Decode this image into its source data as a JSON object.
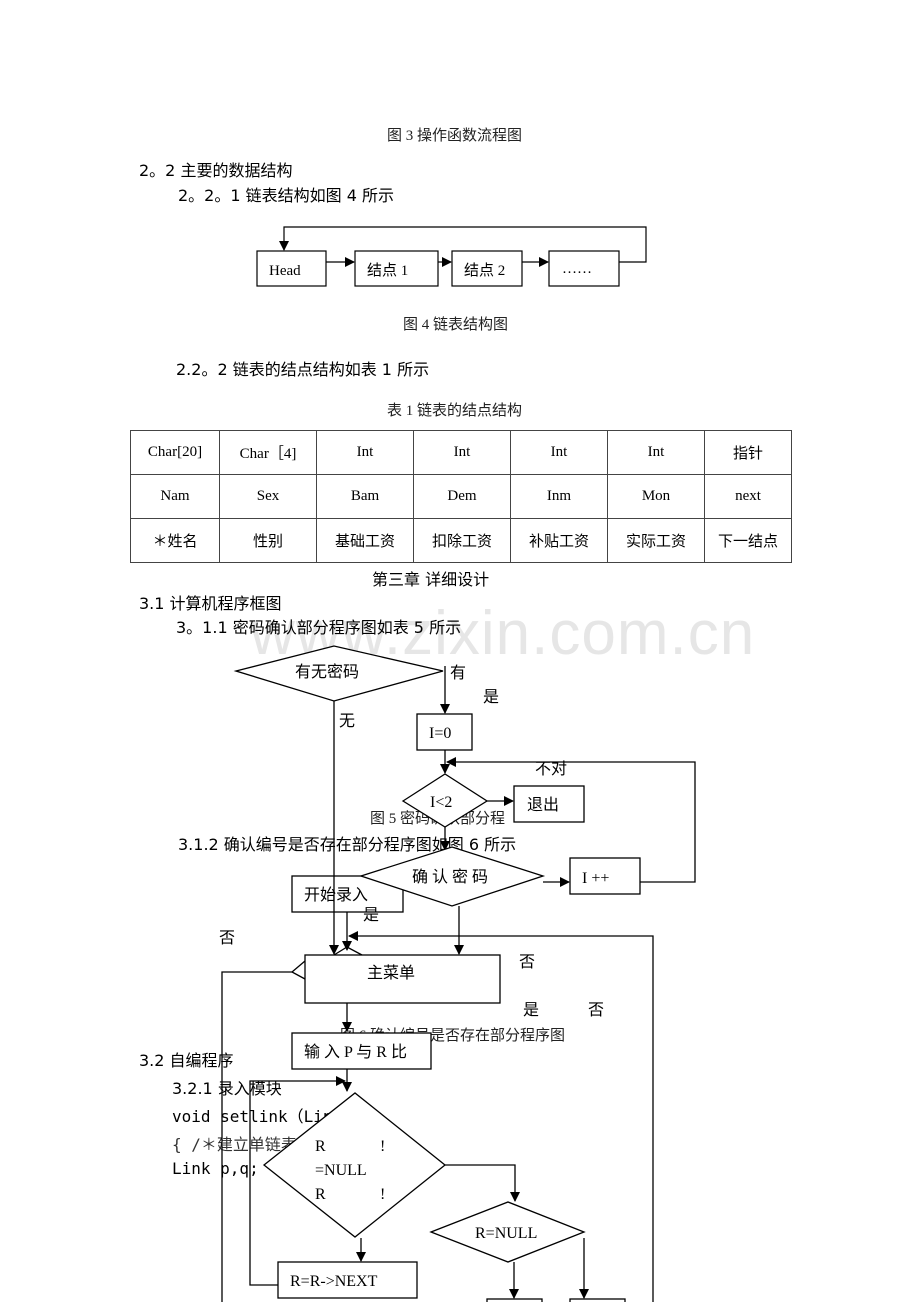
{
  "captions": {
    "fig3": "图 3 操作函数流程图",
    "fig4": "图 4 链表结构图",
    "table1": "表 1 链表的结点结构",
    "fig5": "图 5  密码确认部分程",
    "fig6": "图 6 确认编号是否存在部分程序图"
  },
  "headings": {
    "s2_2": "2。2   主要的数据结构",
    "s2_2_1": "2。2。1 链表结构如图 4 所示",
    "s2_2_2": "2.2。2 链表的结点结构如表 1 所示",
    "chapter3": "第三章        详细设计",
    "s3_1": "3.1   计算机程序框图",
    "s3_1_1": "3。1.1 密码确认部分程序图如表 5 所示",
    "s3_1_2": "3.1.2 确认编号是否存在部分程序图如图 6 所示",
    "s3_2": "3.2   自编程序",
    "s3_2_1": "3.2.1 录入模块"
  },
  "code": {
    "line1": "void setlink（Link l）",
    "line2": "{ /＊建立单链表",
    "line3": "  Link p,q;"
  },
  "linked_list": {
    "nodes": [
      "Head",
      "结点 1",
      "结点 2",
      "……"
    ]
  },
  "node_table": {
    "rows": [
      [
        "Char[20]",
        "Char［4]",
        "Int",
        "Int",
        "Int",
        "Int",
        "指针"
      ],
      [
        "Nam",
        "Sex",
        "Bam",
        "Dem",
        "Inm",
        "Mon",
        "next"
      ],
      [
        "＊姓名",
        "性别",
        "基础工资",
        "扣除工资",
        "补贴工资",
        "实际工资",
        "下一结点"
      ]
    ]
  },
  "flowchart": {
    "has_password": "有无密码",
    "i_zero": "I=0",
    "i_lt_2": "I<2",
    "exit": "退出",
    "confirm_password": "确 认 密 码",
    "i_inc": "I ++",
    "start_input": "开始录入",
    "main_menu": "主菜单",
    "input_p_r": "输 入 P 与 R 比",
    "r_cond_line1_a": "R",
    "r_cond_line1_b": "!",
    "r_cond_line2": "=NULL",
    "r_cond_line3_a": "R",
    "r_cond_line3_b": "!",
    "r_null": "R=NULL",
    "r_next": "R=R->NEXT",
    "labels": {
      "you": "有",
      "shi1": "是",
      "wu": "无",
      "budui": "不对",
      "shi2": "是",
      "fou1": "否",
      "fou2": "否",
      "shi3": "是",
      "fou3": "否"
    }
  },
  "watermark": "www.zixin.com.cn"
}
